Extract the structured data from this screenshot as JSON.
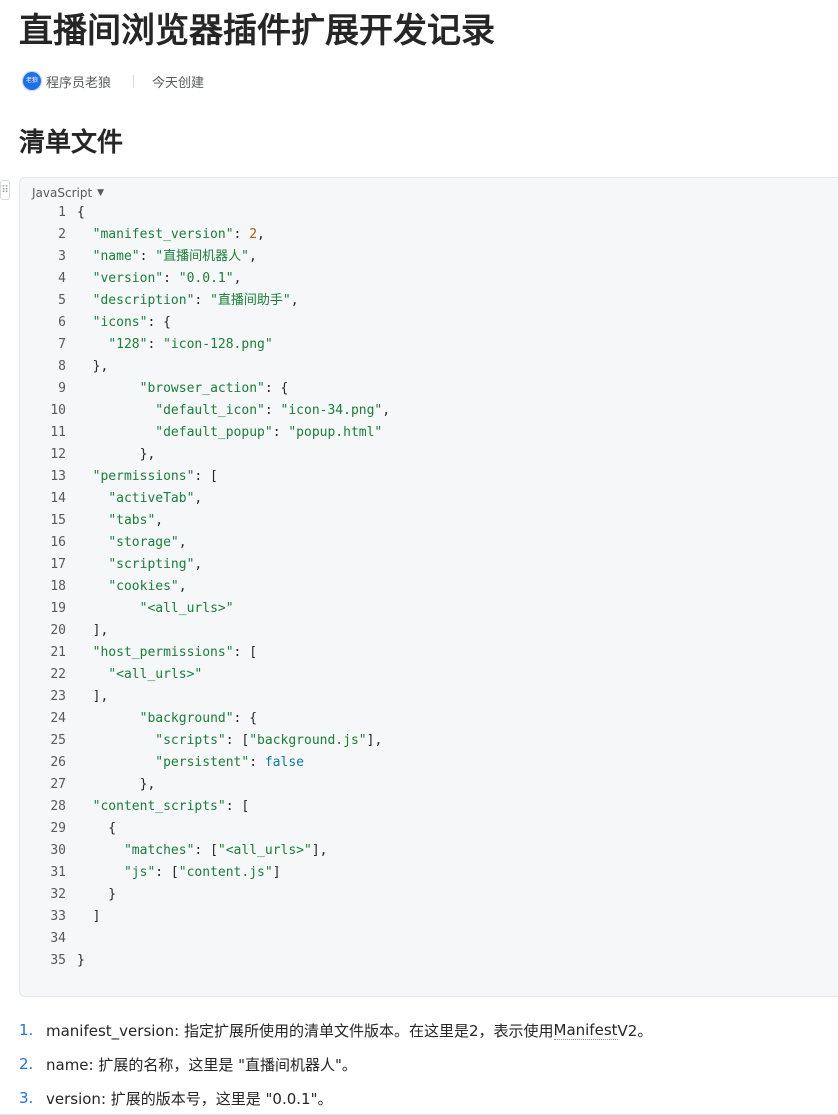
{
  "doc": {
    "title": "直播间浏览器插件扩展开发记录",
    "author": "程序员老狼",
    "avatar_text": "老狼",
    "created": "今天创建",
    "section_heading": "清单文件"
  },
  "code_block": {
    "language": "JavaScript",
    "drag_icon": "drag-handle-icon",
    "lines": [
      [
        {
          "t": "{",
          "c": "p"
        }
      ],
      [
        {
          "t": "  ",
          "c": "p"
        },
        {
          "t": "\"manifest_version\"",
          "c": "key"
        },
        {
          "t": ": ",
          "c": "p"
        },
        {
          "t": "2",
          "c": "num"
        },
        {
          "t": ",",
          "c": "p"
        }
      ],
      [
        {
          "t": "  ",
          "c": "p"
        },
        {
          "t": "\"name\"",
          "c": "key"
        },
        {
          "t": ": ",
          "c": "p"
        },
        {
          "t": "\"直播间机器人\"",
          "c": "str"
        },
        {
          "t": ",",
          "c": "p"
        }
      ],
      [
        {
          "t": "  ",
          "c": "p"
        },
        {
          "t": "\"version\"",
          "c": "key"
        },
        {
          "t": ": ",
          "c": "p"
        },
        {
          "t": "\"0.0.1\"",
          "c": "str"
        },
        {
          "t": ",",
          "c": "p"
        }
      ],
      [
        {
          "t": "  ",
          "c": "p"
        },
        {
          "t": "\"description\"",
          "c": "key"
        },
        {
          "t": ": ",
          "c": "p"
        },
        {
          "t": "\"直播间助手\"",
          "c": "str"
        },
        {
          "t": ",",
          "c": "p"
        }
      ],
      [
        {
          "t": "  ",
          "c": "p"
        },
        {
          "t": "\"icons\"",
          "c": "key"
        },
        {
          "t": ": {",
          "c": "p"
        }
      ],
      [
        {
          "t": "    ",
          "c": "p"
        },
        {
          "t": "\"128\"",
          "c": "key"
        },
        {
          "t": ": ",
          "c": "p"
        },
        {
          "t": "\"icon-128.png\"",
          "c": "str"
        }
      ],
      [
        {
          "t": "  },",
          "c": "p"
        }
      ],
      [
        {
          "t": "        ",
          "c": "p"
        },
        {
          "t": "\"browser_action\"",
          "c": "key"
        },
        {
          "t": ": {",
          "c": "p"
        }
      ],
      [
        {
          "t": "          ",
          "c": "p"
        },
        {
          "t": "\"default_icon\"",
          "c": "key"
        },
        {
          "t": ": ",
          "c": "p"
        },
        {
          "t": "\"icon-34.png\"",
          "c": "str"
        },
        {
          "t": ",",
          "c": "p"
        }
      ],
      [
        {
          "t": "          ",
          "c": "p"
        },
        {
          "t": "\"default_popup\"",
          "c": "key"
        },
        {
          "t": ": ",
          "c": "p"
        },
        {
          "t": "\"popup.html\"",
          "c": "str"
        }
      ],
      [
        {
          "t": "        },",
          "c": "p"
        }
      ],
      [
        {
          "t": "  ",
          "c": "p"
        },
        {
          "t": "\"permissions\"",
          "c": "key"
        },
        {
          "t": ": [",
          "c": "p"
        }
      ],
      [
        {
          "t": "    ",
          "c": "p"
        },
        {
          "t": "\"activeTab\"",
          "c": "str"
        },
        {
          "t": ",",
          "c": "p"
        }
      ],
      [
        {
          "t": "    ",
          "c": "p"
        },
        {
          "t": "\"tabs\"",
          "c": "str"
        },
        {
          "t": ",",
          "c": "p"
        }
      ],
      [
        {
          "t": "    ",
          "c": "p"
        },
        {
          "t": "\"storage\"",
          "c": "str"
        },
        {
          "t": ",",
          "c": "p"
        }
      ],
      [
        {
          "t": "    ",
          "c": "p"
        },
        {
          "t": "\"scripting\"",
          "c": "str"
        },
        {
          "t": ",",
          "c": "p"
        }
      ],
      [
        {
          "t": "    ",
          "c": "p"
        },
        {
          "t": "\"cookies\"",
          "c": "str"
        },
        {
          "t": ",",
          "c": "p"
        }
      ],
      [
        {
          "t": "        ",
          "c": "p"
        },
        {
          "t": "\"<all_urls>\"",
          "c": "str"
        }
      ],
      [
        {
          "t": "  ],",
          "c": "p"
        }
      ],
      [
        {
          "t": "  ",
          "c": "p"
        },
        {
          "t": "\"host_permissions\"",
          "c": "key"
        },
        {
          "t": ": [",
          "c": "p"
        }
      ],
      [
        {
          "t": "    ",
          "c": "p"
        },
        {
          "t": "\"<all_urls>\"",
          "c": "str"
        }
      ],
      [
        {
          "t": "  ],",
          "c": "p"
        }
      ],
      [
        {
          "t": "        ",
          "c": "p"
        },
        {
          "t": "\"background\"",
          "c": "key"
        },
        {
          "t": ": {",
          "c": "p"
        }
      ],
      [
        {
          "t": "          ",
          "c": "p"
        },
        {
          "t": "\"scripts\"",
          "c": "key"
        },
        {
          "t": ": [",
          "c": "p"
        },
        {
          "t": "\"background.js\"",
          "c": "str"
        },
        {
          "t": "],",
          "c": "p"
        }
      ],
      [
        {
          "t": "          ",
          "c": "p"
        },
        {
          "t": "\"persistent\"",
          "c": "key"
        },
        {
          "t": ": ",
          "c": "p"
        },
        {
          "t": "false",
          "c": "kw"
        }
      ],
      [
        {
          "t": "        },",
          "c": "p"
        }
      ],
      [
        {
          "t": "  ",
          "c": "p"
        },
        {
          "t": "\"content_scripts\"",
          "c": "key"
        },
        {
          "t": ": [",
          "c": "p"
        }
      ],
      [
        {
          "t": "    {",
          "c": "p"
        }
      ],
      [
        {
          "t": "      ",
          "c": "p"
        },
        {
          "t": "\"matches\"",
          "c": "key"
        },
        {
          "t": ": [",
          "c": "p"
        },
        {
          "t": "\"<all_urls>\"",
          "c": "str"
        },
        {
          "t": "],",
          "c": "p"
        }
      ],
      [
        {
          "t": "      ",
          "c": "p"
        },
        {
          "t": "\"js\"",
          "c": "key"
        },
        {
          "t": ": [",
          "c": "p"
        },
        {
          "t": "\"content.js\"",
          "c": "str"
        },
        {
          "t": "]",
          "c": "p"
        }
      ],
      [
        {
          "t": "    }",
          "c": "p"
        }
      ],
      [
        {
          "t": "  ]",
          "c": "p"
        }
      ],
      [
        {
          "t": "",
          "c": "p"
        }
      ],
      [
        {
          "t": "}",
          "c": "p"
        }
      ]
    ]
  },
  "list": [
    {
      "num": "1.",
      "text": "manifest_version: 指定扩展所使用的清单文件版本。在这里是2，表示使用",
      "link": "Manifest",
      "after": " V2。"
    },
    {
      "num": "2.",
      "text": "name: 扩展的名称，这里是 \"直播间机器人\"。",
      "link": "",
      "after": ""
    },
    {
      "num": "3.",
      "text": "version: 扩展的版本号，这里是 \"0.0.1\"。",
      "link": "",
      "after": ""
    }
  ]
}
